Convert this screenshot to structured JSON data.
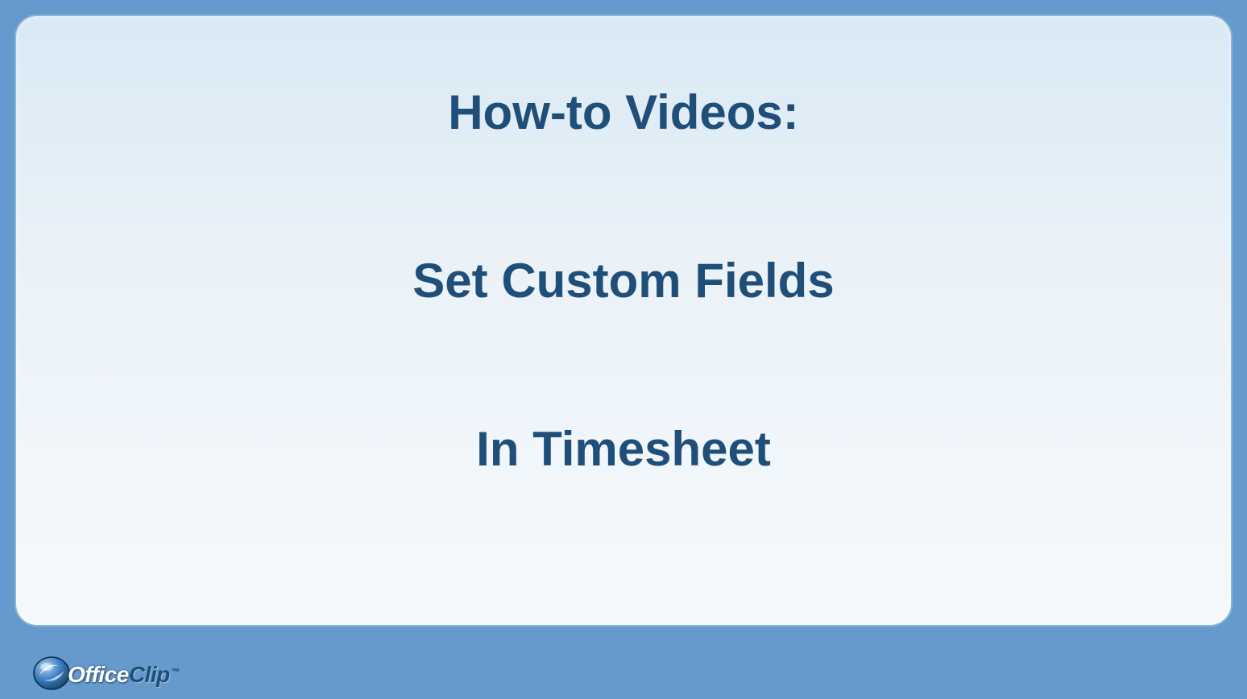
{
  "title_lines": {
    "line1": "How-to Videos:",
    "line2": "Set Custom Fields",
    "line3": "In Timesheet"
  },
  "logo": {
    "part1": "Office",
    "part2": "Clip",
    "tm": "™"
  },
  "colors": {
    "frame_bg": "#6699cc",
    "panel_gradient_top": "#d9e9f5",
    "panel_gradient_bottom": "#f5f9fc",
    "text": "#1f4e79"
  }
}
